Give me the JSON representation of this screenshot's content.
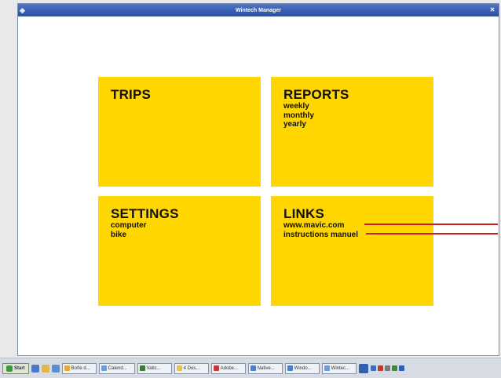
{
  "window": {
    "title": "Wintech Manager",
    "close_glyph": "✕",
    "app_icon": "app-icon"
  },
  "tiles": {
    "trips": {
      "title": "TRIPS"
    },
    "reports": {
      "title": "REPORTS",
      "items": [
        "weekly",
        "monthly",
        "yearly"
      ]
    },
    "settings": {
      "title": "SETTINGS",
      "items": [
        "computer",
        "bike"
      ]
    },
    "links": {
      "title": "LINKS",
      "items": [
        "www.mavic.com",
        "instructions manuel"
      ]
    }
  },
  "colors": {
    "tile": "#ffd600",
    "marker": "#cc1b1b",
    "titlebar": "#2a4f9e"
  },
  "taskbar": {
    "start_label": "Start",
    "tasks": [
      "Boîte d...",
      "Calend...",
      "Vatic...",
      "4 Dos...",
      "Adobe...",
      "Native...",
      "Windo...",
      "Wintec..."
    ]
  }
}
